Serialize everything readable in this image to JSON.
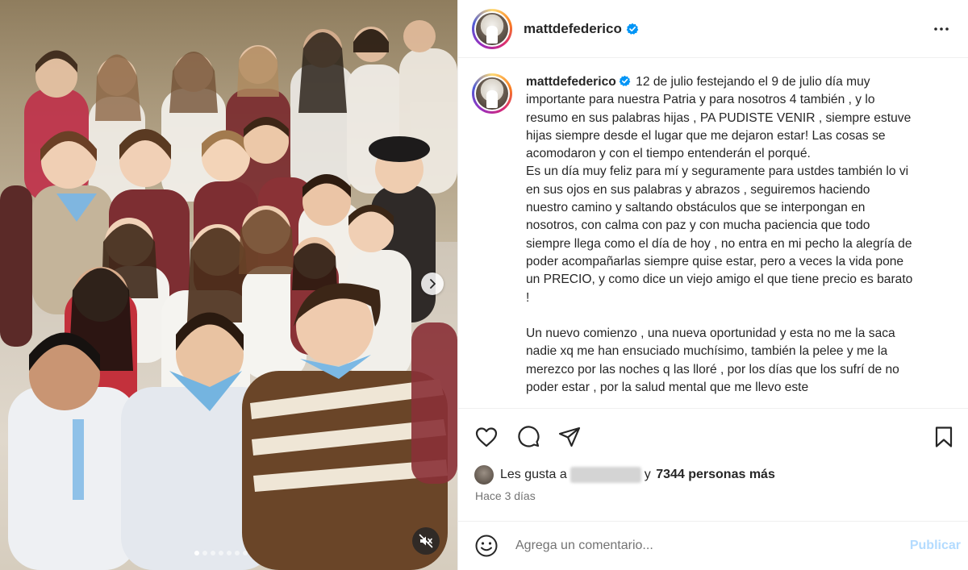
{
  "post": {
    "username": "mattdefederico",
    "more_icon": "more-horizontal-icon",
    "caption": "12 de julio festejando el 9 de julio día muy importante para nuestra Patria y para nosotros 4 también , y lo resumo en sus palabras hijas , PA PUDISTE VENIR , siempre estuve hijas siempre desde el lugar que me dejaron estar! Las cosas se acomodaron y con el tiempo entenderán el porqué.\nEs un día muy feliz para mí y seguramente para ustdes también lo vi en sus ojos en sus palabras y abrazos , seguiremos haciendo nuestro camino y saltando obstáculos que se interpongan en nosotros, con calma con paz y con mucha paciencia que todo siempre llega como el día de hoy , no entra en mi pecho la alegría de poder acompañarlas siempre quise estar, pero a veces la vida pone un PRECIO, y como dice un viejo amigo el que tiene precio es barato !\n\nUn nuevo comienzo , una nueva oportunidad y esta no me la saca nadie xq me han ensuciado muchísimo, también la pelee y me la merezco por las noches q las lloré , por los días que los sufrí de no poder estar , por la salud mental que me llevo este"
  },
  "likes": {
    "prefix": "Les gusta a",
    "connector": "y",
    "count_text": "7344 personas más"
  },
  "date": "Hace 3 días",
  "comment": {
    "placeholder": "Agrega un comentario...",
    "publish_label": "Publicar"
  },
  "carousel": {
    "slide_count": 7,
    "active_index": 0
  },
  "colors": {
    "publish_disabled": "#b3dbff",
    "verified_blue": "#0095f6"
  }
}
